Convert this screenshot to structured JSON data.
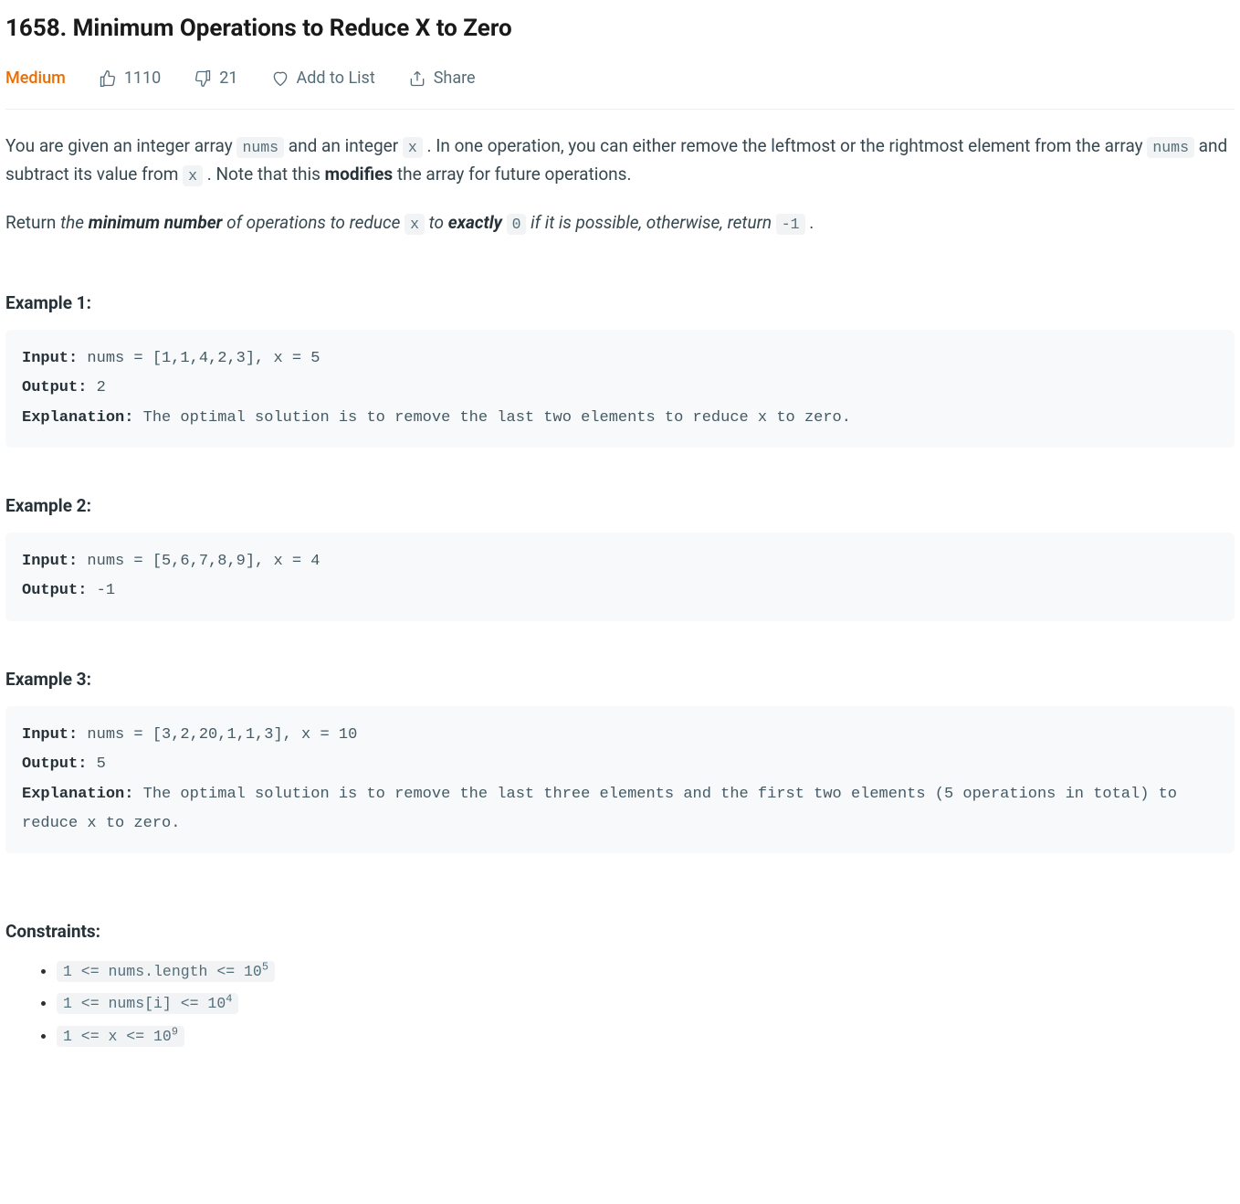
{
  "title": "1658. Minimum Operations to Reduce X to Zero",
  "difficulty": "Medium",
  "meta": {
    "likes": "1110",
    "dislikes": "21",
    "add_to_list": "Add to List",
    "share": "Share"
  },
  "desc": {
    "p1_a": "You are given an integer array ",
    "p1_b": " and an integer ",
    "p1_c": " . In one operation, you can either remove the leftmost or the rightmost element from the array ",
    "p1_d": " and subtract its value from ",
    "p1_e": " . Note that this ",
    "p1_mod": "modifies",
    "p1_f": " the array for future operations.",
    "p2_a": "Return ",
    "p2_b": "the ",
    "p2_c": "minimum number",
    "p2_d": " of operations to reduce ",
    "p2_e": " to ",
    "p2_f": "exactly",
    "p2_g": " ",
    "p2_h": " if it is possible, otherwise, return ",
    "p2_i": " .",
    "code_nums": "nums",
    "code_x": "x",
    "code_zero": "0",
    "code_neg1": "-1"
  },
  "examples": [
    {
      "heading": "Example 1:",
      "input_label": "Input:",
      "input": " nums = [1,1,4,2,3], x = 5",
      "output_label": "Output:",
      "output": " 2",
      "explanation_label": "Explanation:",
      "explanation": " The optimal solution is to remove the last two elements to reduce x to zero."
    },
    {
      "heading": "Example 2:",
      "input_label": "Input:",
      "input": " nums = [5,6,7,8,9], x = 4",
      "output_label": "Output:",
      "output": " -1"
    },
    {
      "heading": "Example 3:",
      "input_label": "Input:",
      "input": " nums = [3,2,20,1,1,3], x = 10",
      "output_label": "Output:",
      "output": " 5",
      "explanation_label": "Explanation:",
      "explanation": " The optimal solution is to remove the last three elements and the first two elements (5 operations in total) to reduce x to zero."
    }
  ],
  "constraints": {
    "heading": "Constraints:",
    "items": [
      {
        "pre": "1 <= nums.length <= 10",
        "sup": "5"
      },
      {
        "pre": "1 <= nums[i] <= 10",
        "sup": "4"
      },
      {
        "pre": "1 <= x <= 10",
        "sup": "9"
      }
    ]
  }
}
